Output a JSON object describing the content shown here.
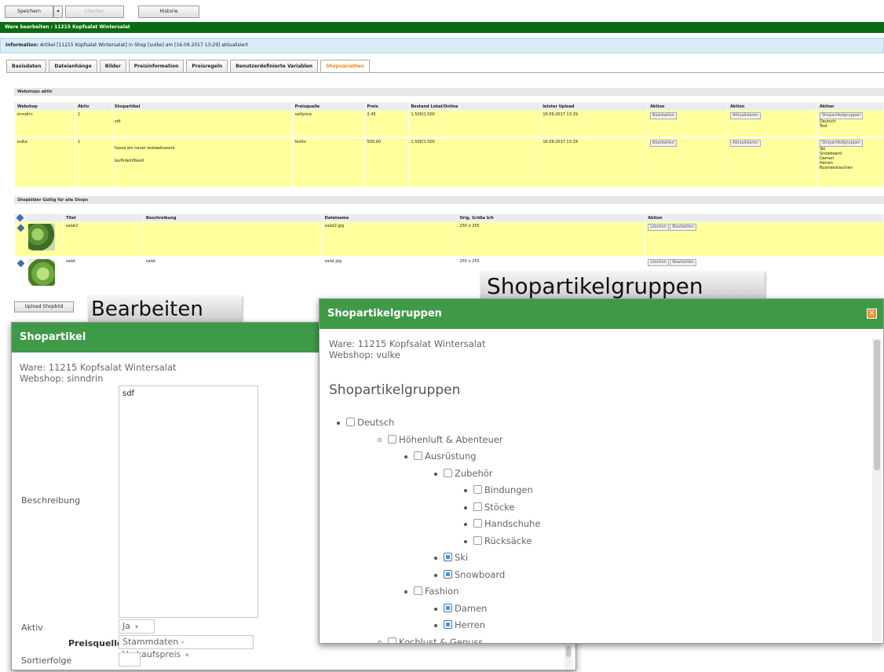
{
  "toolbar": {
    "save_label": "Speichern",
    "save_dropdown": "▾",
    "delete_label": "Löschen",
    "history_label": "Historie"
  },
  "title_bar": "Ware bearbeiten : 11215 Kopfsalat Wintersalat",
  "info": {
    "label": "Information:",
    "text": "Artikel [11215 Kopfsalat Wintersalat] in Shop [vulke] am [16.09.2017 13:29] aktualisiert"
  },
  "tabs": [
    "Basisdaten",
    "Dateianhänge",
    "Bilder",
    "Preisinformation",
    "Preisregeln",
    "Benutzerdefinierte Variablen",
    "Shopvariablen"
  ],
  "webshops": {
    "heading": "Webshops aktiv",
    "columns": [
      "Webshop",
      "Aktiv",
      "Shopartikel",
      "Preisquelle",
      "Preis",
      "Bestand Lokal/Online",
      "letzter Upload",
      "Aktion",
      "Aktion",
      "Aktion"
    ],
    "rows": [
      {
        "webshop": "sinndrin",
        "aktiv": "1",
        "shopartikel_lines": [
          "sdf"
        ],
        "preisquelle": "selfprice",
        "preis": "2,45",
        "bestand": "1.500/1.500",
        "upload": "16.09.2017 13:29",
        "edit": "Bearbeiten",
        "update": "Aktualisieren",
        "groups": "Shopartikelgruppen",
        "group_list": [
          "Deutsch",
          "Test"
        ]
      },
      {
        "webshop": "vulke",
        "aktiv": "1",
        "shopartikel_lines": [
          "hasso ein neuer testwebseorie",
          "laufhdeinfbasd"
        ],
        "preisquelle": "festto",
        "preis": "500,00",
        "bestand": "1.500/1.500",
        "upload": "16.09.2017 13:29",
        "edit": "Bearbeiten",
        "update": "Aktualisieren",
        "groups": "Shopartikelgruppen",
        "group_list": [
          "Ski",
          "Snowboard",
          "Damen",
          "Herren",
          "Businesstaschen"
        ]
      }
    ]
  },
  "shopimages": {
    "heading": "Shopbilder Gültig für alle Shops",
    "columns": [
      "Titel",
      "Beschreibung",
      "Dateiname",
      "Orig. Größe b/h",
      "Aktion"
    ],
    "rows": [
      {
        "titel": "salat2",
        "beschreibung": "",
        "dateiname": "salat2.jpg",
        "groesse": "255 x 255",
        "delete": "Löschen",
        "edit": "Bearbeiten"
      },
      {
        "titel": "salat",
        "beschreibung": "salat",
        "dateiname": "salat.jpg",
        "groesse": "255 x 255",
        "delete": "Löschen",
        "edit": "Bearbeiten"
      }
    ],
    "upload_label": "Upload Shopbild"
  },
  "callouts": {
    "edit": "Bearbeiten",
    "groups": "Shopartikelgruppen"
  },
  "shopartikel_dialog": {
    "title": "Shopartikel",
    "ware": "Ware: 11215 Kopfsalat Wintersalat",
    "webshop": "Webshop: sinndrin",
    "beschreibung_label": "Beschreibung",
    "beschreibung_value": "sdf",
    "aktiv_label": "Aktiv",
    "aktiv_value": "Ja",
    "preisquelle_label": "Preisquelle",
    "preisquelle_value": "Stammdaten - Verkaufspreis",
    "sortierfolge_label": "Sortierfolge"
  },
  "groups_dialog": {
    "title": "Shopartikelgruppen",
    "close": "✕",
    "ware": "Ware: 11215 Kopfsalat Wintersalat",
    "webshop": "Webshop: vulke",
    "heading": "Shopartikelgruppen",
    "tree": [
      {
        "label": "Deutsch",
        "checked": false
      },
      {
        "label": "Höhenluft & Abenteuer",
        "checked": false
      },
      {
        "label": "Ausrüstung",
        "checked": false
      },
      {
        "label": "Zubehör",
        "checked": false
      },
      {
        "label": "Bindungen",
        "checked": false
      },
      {
        "label": "Stöcke",
        "checked": false
      },
      {
        "label": "Handschuhe",
        "checked": false
      },
      {
        "label": "Rücksäcke",
        "checked": false
      },
      {
        "label": "Ski",
        "checked": true
      },
      {
        "label": "Snowboard",
        "checked": true
      },
      {
        "label": "Fashion",
        "checked": false
      },
      {
        "label": "Damen",
        "checked": true
      },
      {
        "label": "Herren",
        "checked": true
      },
      {
        "label": "Kochlust & Genuss",
        "checked": false
      }
    ]
  },
  "colors": {
    "green_dark": "#0a6b12",
    "dialog_green": "#3f9a47",
    "highlight_row": "#ffff9e",
    "active_tab": "#f08a24",
    "close_orange": "#f58d2d",
    "checkbox_blue": "#4f93db"
  }
}
